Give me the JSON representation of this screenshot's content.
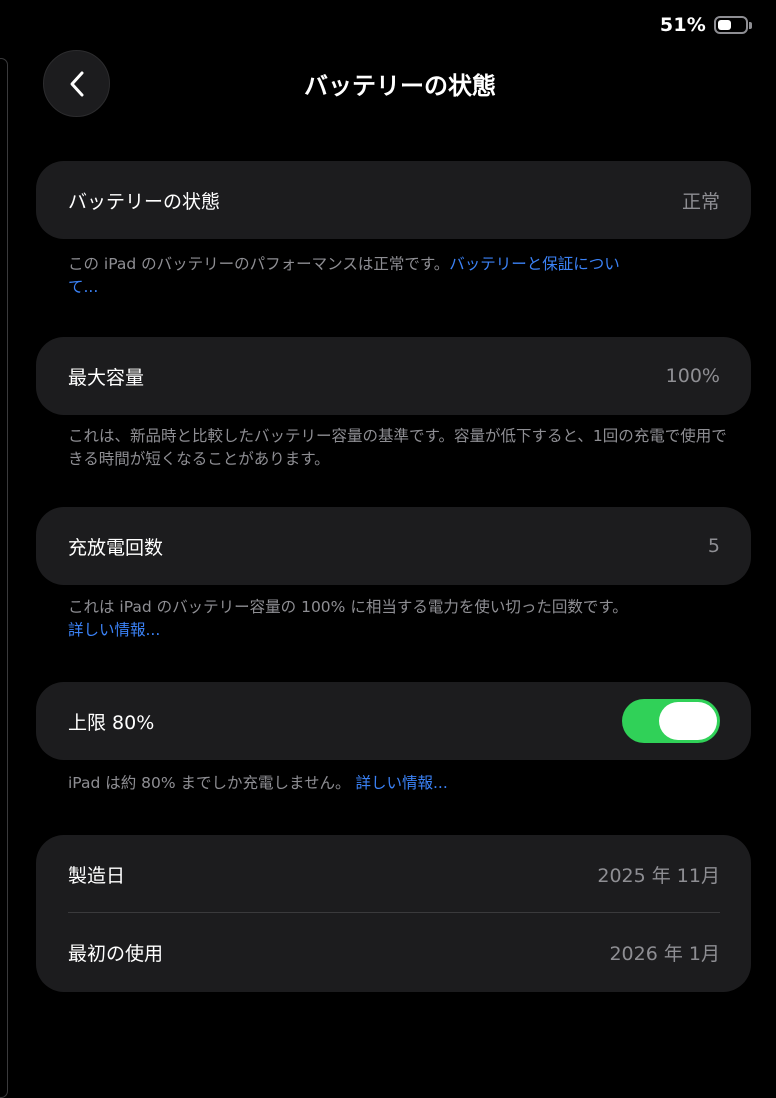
{
  "status_bar": {
    "battery_percent": "51%",
    "battery_level": 0.51
  },
  "nav": {
    "title": "バッテリーの状態"
  },
  "health": {
    "label": "バッテリーの状態",
    "value": "正常",
    "footnote": "この iPad のバッテリーのパフォーマンスは正常です。",
    "link": "バッテリーと保証について..."
  },
  "capacity": {
    "label": "最大容量",
    "value": "100%",
    "footnote": "これは、新品時と比較したバッテリー容量の基準です。容量が低下すると、1回の充電で使用できる時間が短くなることがあります。"
  },
  "cycles": {
    "label": "充放電回数",
    "value": "5",
    "footnote": "これは iPad のバッテリー容量の 100% に相当する電力を使い切った回数です。",
    "link": "詳しい情報..."
  },
  "limit": {
    "label": "上限 80%",
    "enabled": true,
    "footnote": "iPad は約 80% までしか充電しません。",
    "link": "詳しい情報..."
  },
  "dates": {
    "manufacture_label": "製造日",
    "manufacture_value": "2025 年 11月",
    "first_use_label": "最初の使用",
    "first_use_value": "2026 年 1月"
  },
  "colors": {
    "background": "#000000",
    "card": "#1c1c1e",
    "secondary_text": "#8e8e93",
    "link": "#3b82f6",
    "toggle_on": "#30d158"
  }
}
